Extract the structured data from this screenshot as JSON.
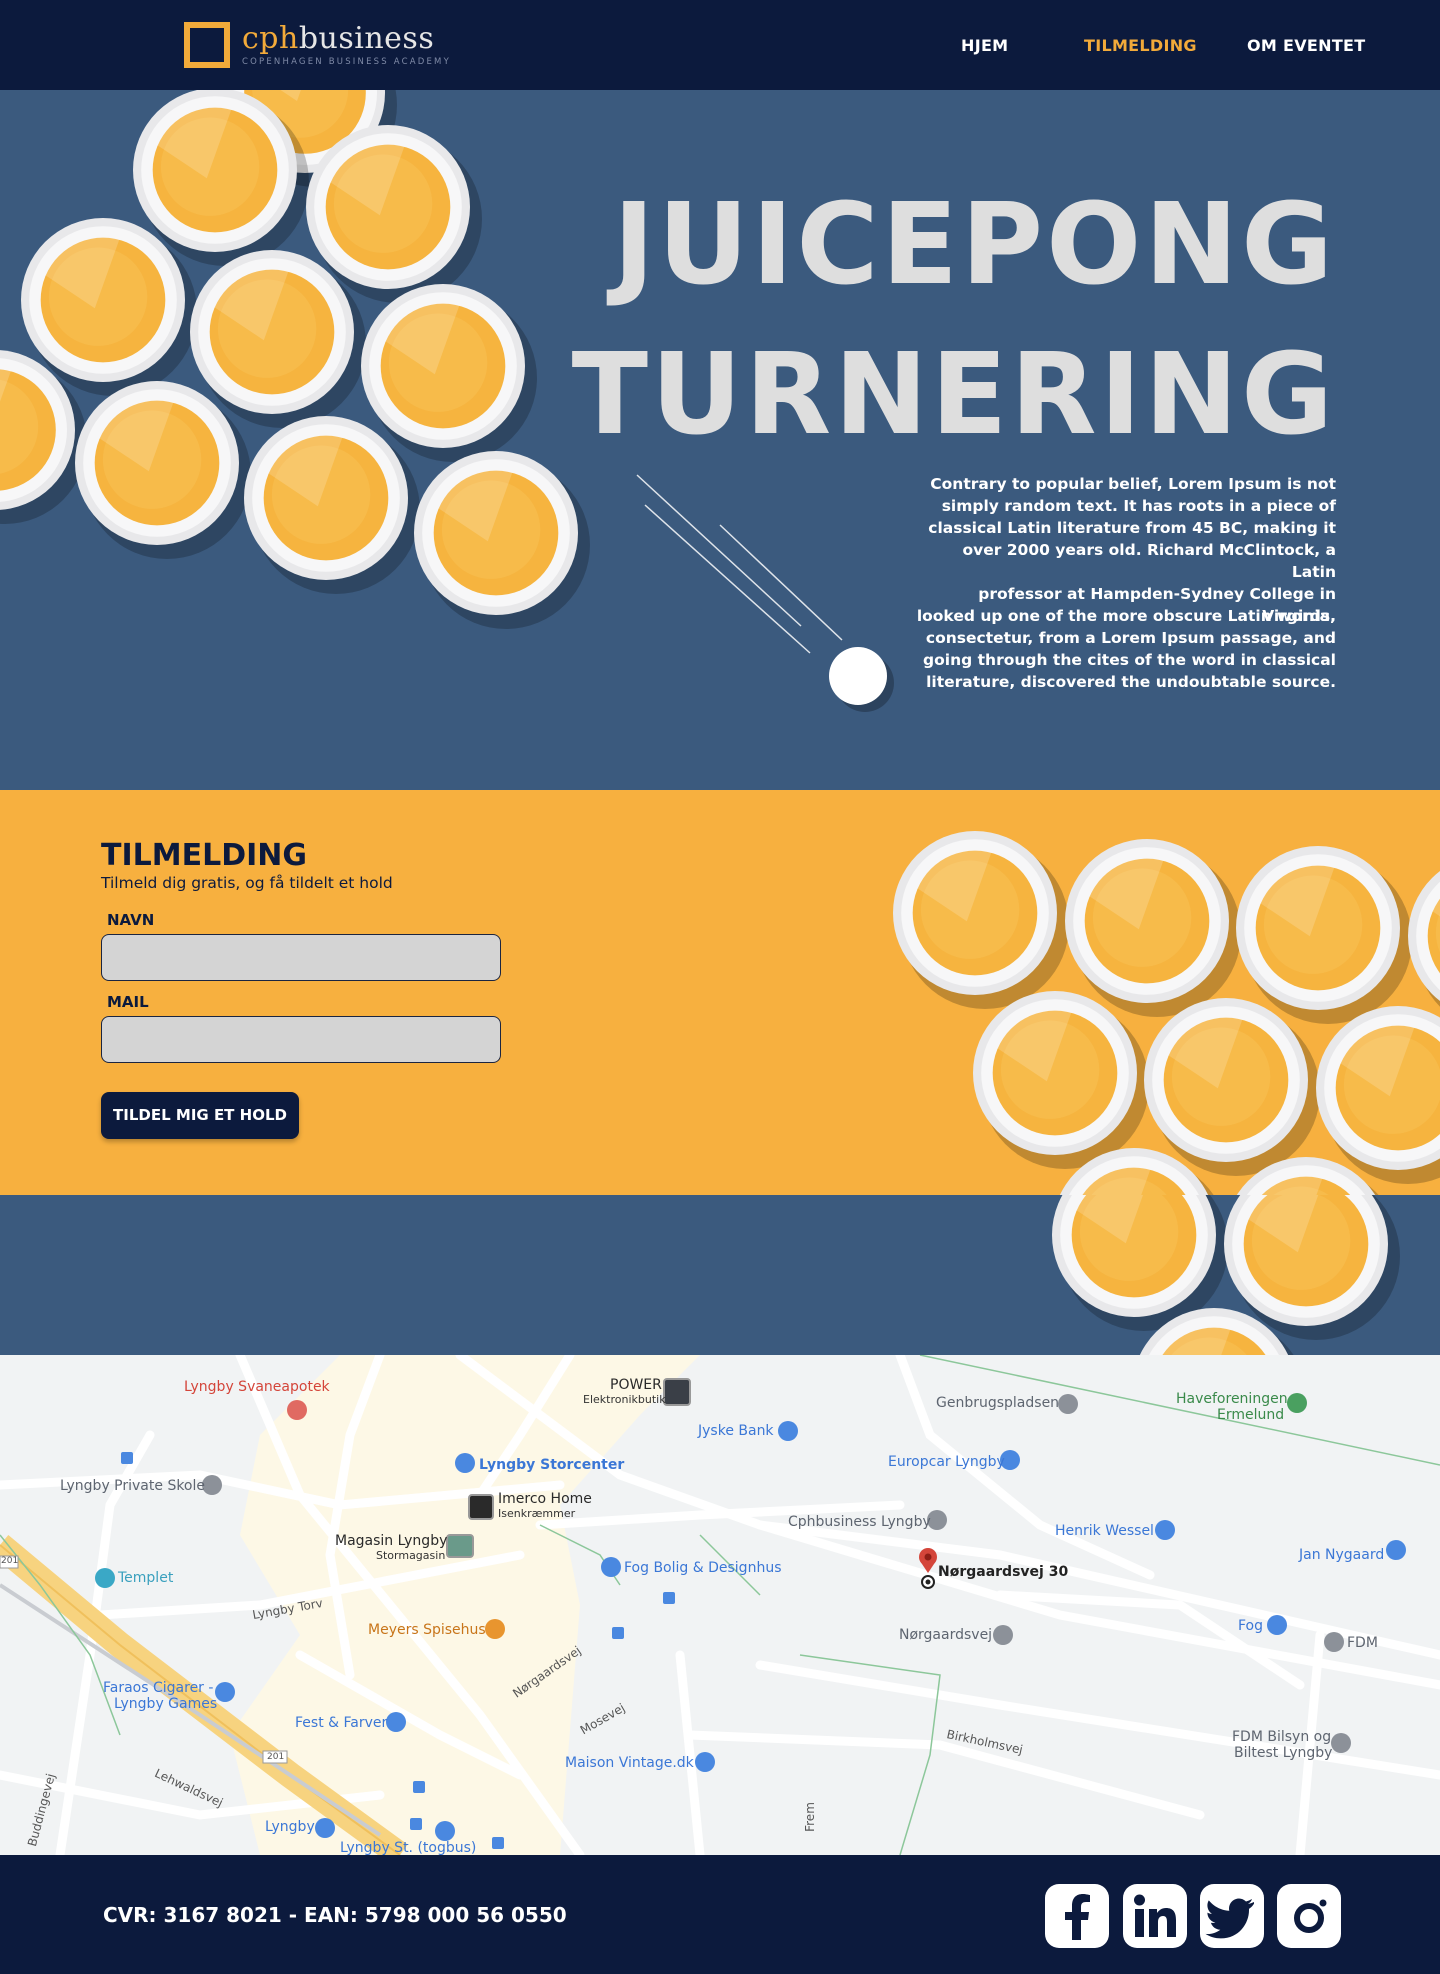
{
  "nav": {
    "logo_name_part1": "cph",
    "logo_name_part2": "business",
    "logo_subtitle": "COPENHAGEN BUSINESS ACADEMY",
    "links": [
      {
        "label": "HJEM",
        "active": false
      },
      {
        "label": "TILMELDING",
        "active": true
      },
      {
        "label": "OM EVENTET",
        "active": false
      }
    ]
  },
  "hero": {
    "title_line1": "JUICEPONG",
    "title_line2": "TURNERING",
    "paragraph1_lines": [
      "Contrary to popular belief, Lorem Ipsum is not",
      "simply random text. It has roots in a piece of",
      "classical Latin literature from 45 BC, making it",
      "over 2000 years old. Richard McClintock, a Latin",
      "professor at Hampden-Sydney College in Virginia,"
    ],
    "paragraph2_lines": [
      "looked up one of the more obscure Latin words,",
      "consectetur, from a Lorem Ipsum passage, and",
      "going through the cites of the word in classical",
      "literature, discovered the undoubtable source."
    ]
  },
  "signup": {
    "title": "TILMELDING",
    "subtitle": "Tilmeld dig gratis, og få tildelt et hold",
    "name_label": "NAVN",
    "name_value": "",
    "mail_label": "MAIL",
    "mail_value": "",
    "button_label": "TILDEL MIG ET HOLD"
  },
  "map": {
    "labels": {
      "svaneapotek": "Lyngby Svaneapotek",
      "power": "POWER",
      "power_sub": "Elektronikbutik",
      "genbrug": "Genbrugspladsen",
      "havef1": "Haveforeningen",
      "havef2": "Ermelund",
      "jyske": "Jyske Bank",
      "europcar": "Europcar Lyngby",
      "storcenter": "Lyngby Storcenter",
      "private_skole": "Lyngby Private Skole",
      "imerco": "Imerco Home",
      "imerco_sub": "Isenkræmmer",
      "cphbusiness": "Cphbusiness Lyngby",
      "henrik": "Henrik Wessel",
      "jan": "Jan Nygaard",
      "magasin": "Magasin Lyngby",
      "magasin_sub": "Stormagasin",
      "templet": "Templet",
      "fog_bolig": "Fog Bolig & Designhus",
      "norgaardsvej30": "Nørgaardsvej 30",
      "lyngby_torv": "Lyngby Torv",
      "meyers": "Meyers Spisehus",
      "norgaardsvej": "Nørgaardsvej",
      "fog": "Fog",
      "fdm": "FDM",
      "faraos1": "Faraos Cigarer -",
      "faraos2": "Lyngby Games",
      "norgaardsvej_road": "Nørgaardsvej",
      "fest": "Fest & Farver",
      "mosevej": "Mosevej",
      "birkholmsvej": "Birkholmsvej",
      "fdm_bilsyn1": "FDM Bilsyn og",
      "fdm_bilsyn2": "Biltest Lyngby",
      "road_201a": "201",
      "road_201b": "201",
      "lehwaldsvej": "Lehwaldsvej",
      "maison": "Maison Vintage.dk",
      "buddingevej": "Buddingevej",
      "lyngby": "Lyngby",
      "lyngby_st": "Lyngby St. (togbus)",
      "frem": "Frem"
    }
  },
  "footer": {
    "text": "CVR: 3167 8021 - EAN: 5798 000 56 0550",
    "social": [
      "facebook-icon",
      "linkedin-icon",
      "twitter-icon",
      "instagram-icon"
    ]
  },
  "colors": {
    "navy": "#0c1a3d",
    "blue": "#3b5a7e",
    "orange": "#f7b03f",
    "accent": "#f2aa3a"
  }
}
